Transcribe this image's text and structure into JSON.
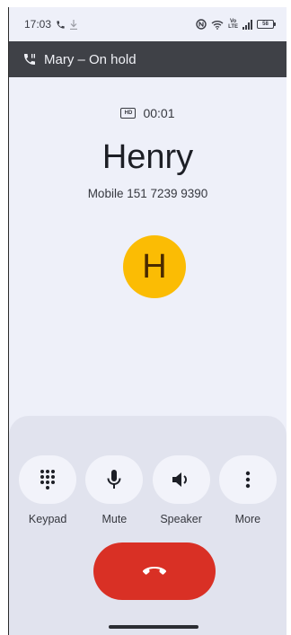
{
  "status_bar": {
    "time": "17:03",
    "battery": "58",
    "volte": "Vo",
    "lte": "LTE",
    "icons": [
      "phone-icon",
      "download-icon",
      "nfc-icon",
      "wifi-icon",
      "volte-icon",
      "signal-icon",
      "battery-icon"
    ]
  },
  "hold_banner": {
    "text": "Mary – On hold",
    "icon": "phone-hold-icon"
  },
  "call": {
    "hd_label": "HD",
    "timer": "00:01",
    "name": "Henry",
    "number": "Mobile 151 7239 9390",
    "avatar_letter": "H",
    "avatar_color": "#fbbc04"
  },
  "controls": {
    "keypad": "Keypad",
    "mute": "Mute",
    "speaker": "Speaker",
    "more": "More"
  },
  "colors": {
    "end_call": "#d93025",
    "banner": "#3f4147",
    "background": "#eef0f9"
  }
}
